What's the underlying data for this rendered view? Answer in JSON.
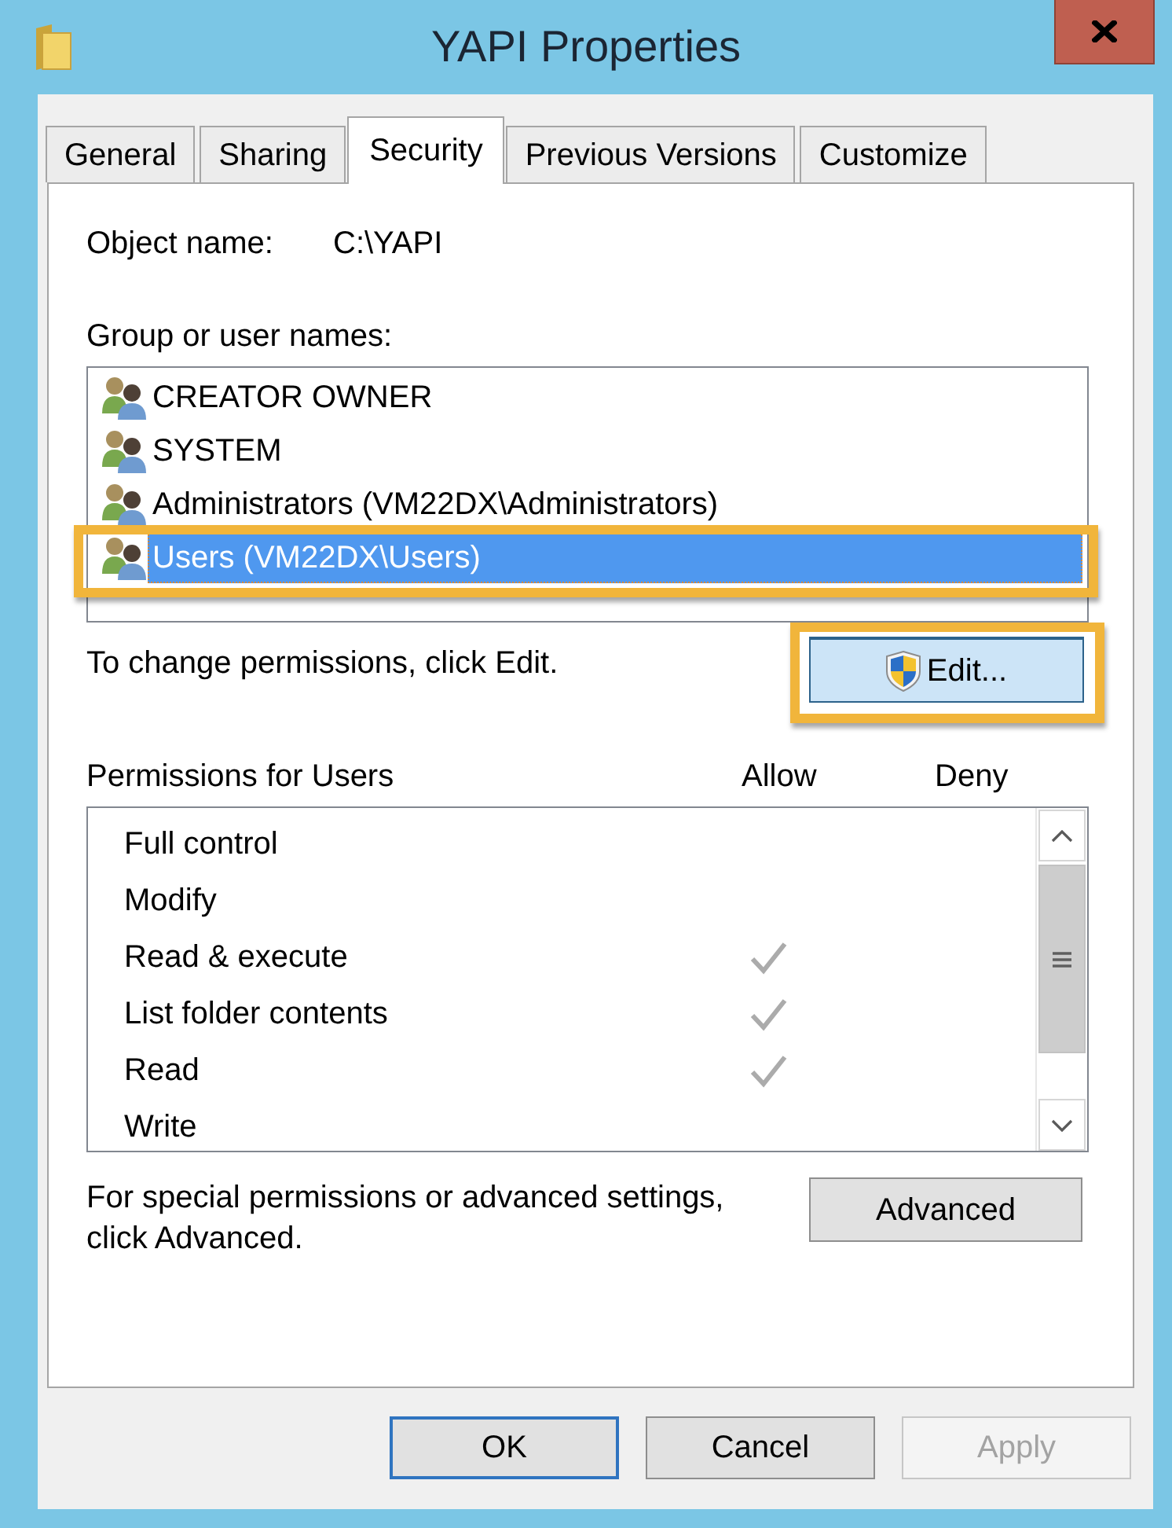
{
  "window": {
    "title": "YAPI Properties"
  },
  "tabs": [
    {
      "label": "General",
      "selected": false
    },
    {
      "label": "Sharing",
      "selected": false
    },
    {
      "label": "Security",
      "selected": true
    },
    {
      "label": "Previous Versions",
      "selected": false
    },
    {
      "label": "Customize",
      "selected": false
    }
  ],
  "object_name": {
    "label": "Object name:",
    "value": "C:\\YAPI"
  },
  "group_list": {
    "label": "Group or user names:",
    "items": [
      {
        "name": "CREATOR OWNER",
        "selected": false,
        "highlighted": false
      },
      {
        "name": "SYSTEM",
        "selected": false,
        "highlighted": false
      },
      {
        "name": "Administrators (VM22DX\\Administrators)",
        "selected": false,
        "highlighted": false
      },
      {
        "name": "Users (VM22DX\\Users)",
        "selected": true,
        "highlighted": true
      }
    ]
  },
  "edit_hint": "To change permissions, click Edit.",
  "edit_button": {
    "label": "Edit...",
    "hovered": true,
    "highlighted": true
  },
  "permissions": {
    "label": "Permissions for Users",
    "columns": [
      "Allow",
      "Deny"
    ],
    "rows": [
      {
        "name": "Full control",
        "allow": false,
        "deny": false
      },
      {
        "name": "Modify",
        "allow": false,
        "deny": false
      },
      {
        "name": "Read & execute",
        "allow": true,
        "deny": false
      },
      {
        "name": "List folder contents",
        "allow": true,
        "deny": false
      },
      {
        "name": "Read",
        "allow": true,
        "deny": false
      },
      {
        "name": "Write",
        "allow": false,
        "deny": false
      }
    ]
  },
  "advanced": {
    "text": "For special permissions or advanced settings, click Advanced.",
    "button": "Advanced"
  },
  "buttons": [
    {
      "label": "OK",
      "default": true,
      "disabled": false
    },
    {
      "label": "Cancel",
      "default": false,
      "disabled": false
    },
    {
      "label": "Apply",
      "default": false,
      "disabled": true
    }
  ]
}
